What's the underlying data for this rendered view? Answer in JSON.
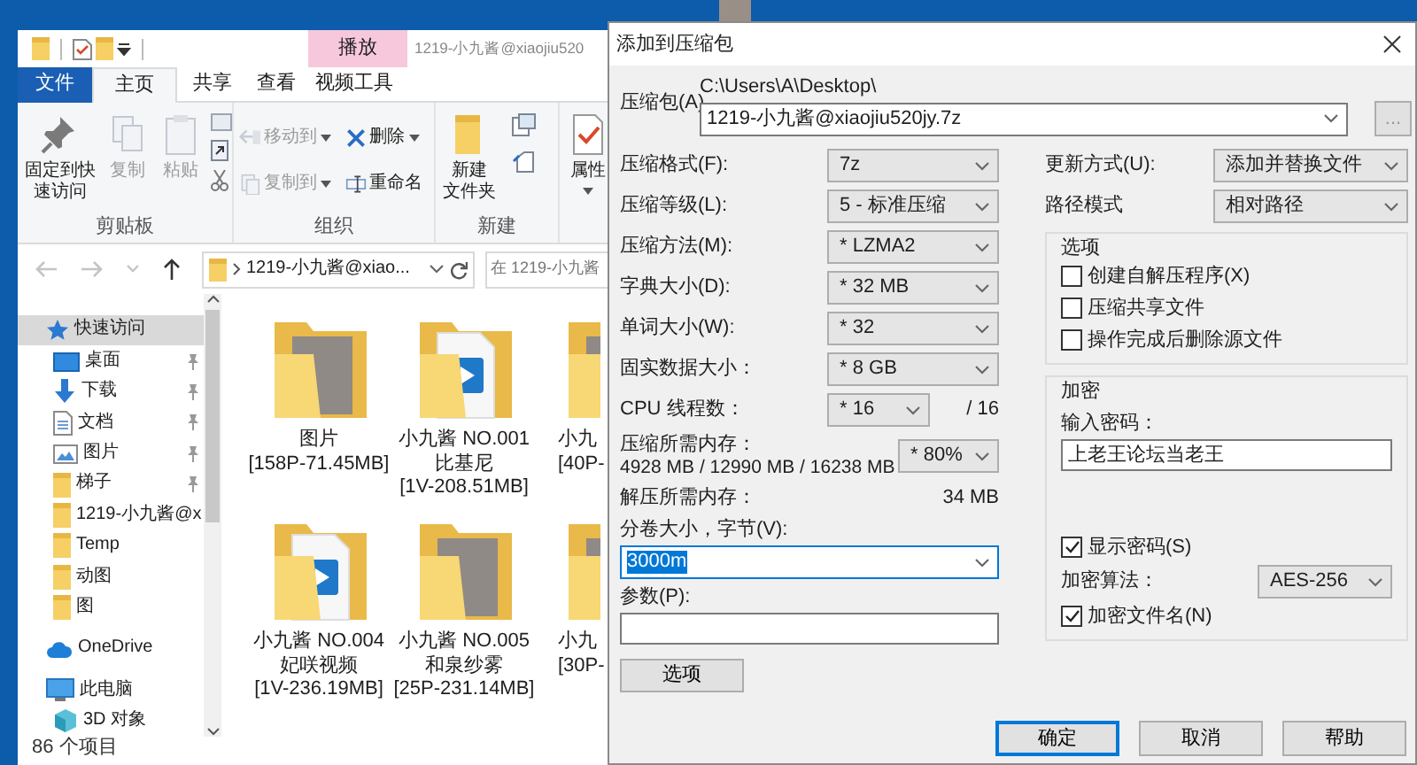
{
  "explorer": {
    "title": "1219-小九酱@xiaojiu520",
    "contextual_tab_header": "播放",
    "ribbon_tabs": [
      {
        "label": "文件",
        "kind": "file",
        "selected": false
      },
      {
        "label": "主页",
        "kind": "tab",
        "selected": true
      },
      {
        "label": "共享",
        "kind": "tab",
        "selected": false
      },
      {
        "label": "查看",
        "kind": "tab",
        "selected": false
      },
      {
        "label": "视频工具",
        "kind": "tab",
        "selected": false
      }
    ],
    "ribbon_groups": [
      {
        "label": "剪贴板",
        "items": [
          {
            "kind": "large",
            "label_lines": [
              "固定到快",
              "速访问"
            ],
            "disabled": false,
            "dropdown": false
          },
          {
            "kind": "large",
            "label_lines": [
              "复制"
            ],
            "disabled": true,
            "dropdown": false
          },
          {
            "kind": "large",
            "label_lines": [
              "粘贴"
            ],
            "disabled": true,
            "dropdown": false
          }
        ]
      },
      {
        "label": "组织",
        "items": [
          {
            "kind": "small",
            "label_lines": [
              "移动到"
            ],
            "disabled": true,
            "dropdown": true
          },
          {
            "kind": "small",
            "label_lines": [
              "复制到"
            ],
            "disabled": true,
            "dropdown": true
          },
          {
            "kind": "small",
            "label_lines": [
              "删除"
            ],
            "disabled": false,
            "dropdown": true
          },
          {
            "kind": "small",
            "label_lines": [
              "重命名"
            ],
            "disabled": false,
            "dropdown": false
          }
        ]
      },
      {
        "label": "新建",
        "items": [
          {
            "kind": "large",
            "label_lines": [
              "新建",
              "文件夹"
            ],
            "disabled": false,
            "dropdown": false
          }
        ]
      },
      {
        "items": [
          {
            "kind": "large",
            "label_lines": [
              "属性"
            ],
            "disabled": false,
            "dropdown": true
          }
        ]
      }
    ],
    "nav_buttons": [
      {
        "kind": "back",
        "disabled": true
      },
      {
        "kind": "forward",
        "disabled": true
      },
      {
        "kind": "recent",
        "disabled": true
      },
      {
        "kind": "up",
        "disabled": false
      }
    ],
    "address": "1219-小九酱@xiao...",
    "search": {
      "placeholder": "在 1219-小九酱"
    },
    "navigation": [
      {
        "label": "快速访问",
        "kind": "star",
        "selected": true,
        "pinned": false,
        "children": [
          {
            "label": "桌面",
            "kind": "desktop",
            "selected": false,
            "pinned": true
          },
          {
            "label": "下载",
            "kind": "download",
            "selected": false,
            "pinned": true
          },
          {
            "label": "文档",
            "kind": "document",
            "selected": false,
            "pinned": true
          },
          {
            "label": "图片",
            "kind": "pictures",
            "selected": false,
            "pinned": true
          },
          {
            "label": "梯子",
            "kind": "folder",
            "selected": false,
            "pinned": true
          },
          {
            "label": "1219-小九酱@x",
            "kind": "folder",
            "selected": false,
            "pinned": false
          },
          {
            "label": "Temp",
            "kind": "folder",
            "selected": false,
            "pinned": false
          },
          {
            "label": "动图",
            "kind": "folder",
            "selected": false,
            "pinned": false
          },
          {
            "label": "图",
            "kind": "folder",
            "selected": false,
            "pinned": false
          }
        ]
      },
      {
        "label": "OneDrive",
        "kind": "cloud",
        "selected": false,
        "pinned": false
      },
      {
        "label": "此电脑",
        "kind": "pc",
        "selected": false,
        "pinned": false,
        "children": [
          {
            "label": "3D 对象",
            "kind": "cube",
            "selected": false,
            "pinned": false
          }
        ]
      }
    ],
    "files": [
      {
        "kind": "photo",
        "cut": false,
        "lines": [
          "图片",
          "[158P-71.45MB]"
        ]
      },
      {
        "kind": "video",
        "cut": false,
        "lines": [
          "小九酱 NO.001",
          "比基尼",
          "[1V-208.51MB]"
        ]
      },
      {
        "kind": "photo",
        "cut": true,
        "lines": [
          "小九",
          "[40P-"
        ]
      },
      {
        "kind": "video",
        "cut": false,
        "lines": [
          "小九酱 NO.004",
          "妃咲视频",
          "[1V-236.19MB]"
        ]
      },
      {
        "kind": "photo",
        "cut": false,
        "lines": [
          "小九酱 NO.005",
          "和泉纱雾",
          "[25P-231.14MB]"
        ]
      },
      {
        "kind": "photo",
        "cut": true,
        "lines": [
          "小九",
          "[30P-"
        ]
      }
    ],
    "status": "86 个项目"
  },
  "dialog": {
    "title": "添加到压缩包",
    "archive": {
      "label": "压缩包(A)",
      "path": "C:\\Users\\A\\Desktop\\",
      "value": "1219-小九酱@xiaojiu520jy.7z",
      "browse": "..."
    },
    "left_settings": [
      {
        "label": "压缩格式(F):",
        "value": "7z"
      },
      {
        "label": "压缩等级(L):",
        "value": "5 - 标准压缩"
      },
      {
        "label": "压缩方法(M):",
        "value": "* LZMA2"
      },
      {
        "label": "字典大小(D):",
        "value": "* 32 MB"
      },
      {
        "label": "单词大小(W):",
        "value": "* 32"
      },
      {
        "label": "固实数据大小：",
        "value": "* 8 GB"
      },
      {
        "label": "CPU 线程数：",
        "value": "* 16",
        "suffix": "/ 16"
      }
    ],
    "memory": {
      "label": "压缩所需内存：",
      "detail": "4928 MB / 12990 MB / 16238 MB",
      "value": "* 80%"
    },
    "decompress_memory": {
      "label": "解压所需内存：",
      "value": "34 MB"
    },
    "volume": {
      "label": "分卷大小，字节(V):",
      "value": "3000m",
      "text_selected": true
    },
    "parameters": {
      "label": "参数(P):"
    },
    "options_button": "选项",
    "right_settings": [
      {
        "label": "更新方式(U):",
        "value": "添加并替换文件"
      },
      {
        "label": "路径模式",
        "value": "相对路径"
      }
    ],
    "options_group": {
      "title": "选项",
      "checkboxes": [
        {
          "label": "创建自解压程序(X)",
          "checked": false
        },
        {
          "label": "压缩共享文件",
          "checked": false
        },
        {
          "label": "操作完成后删除源文件",
          "checked": false
        }
      ]
    },
    "encryption": {
      "title": "加密",
      "password_label": "输入密码：",
      "password": "上老王论坛当老王",
      "show_password": {
        "label": "显示密码(S)",
        "checked": true
      },
      "method_label": "加密算法：",
      "method": "AES-256",
      "encrypt_names": {
        "label": "加密文件名(N)",
        "checked": true
      }
    },
    "buttons": [
      {
        "label": "确定",
        "default": true
      },
      {
        "label": "取消",
        "default": false
      },
      {
        "label": "帮助",
        "default": false
      }
    ]
  }
}
